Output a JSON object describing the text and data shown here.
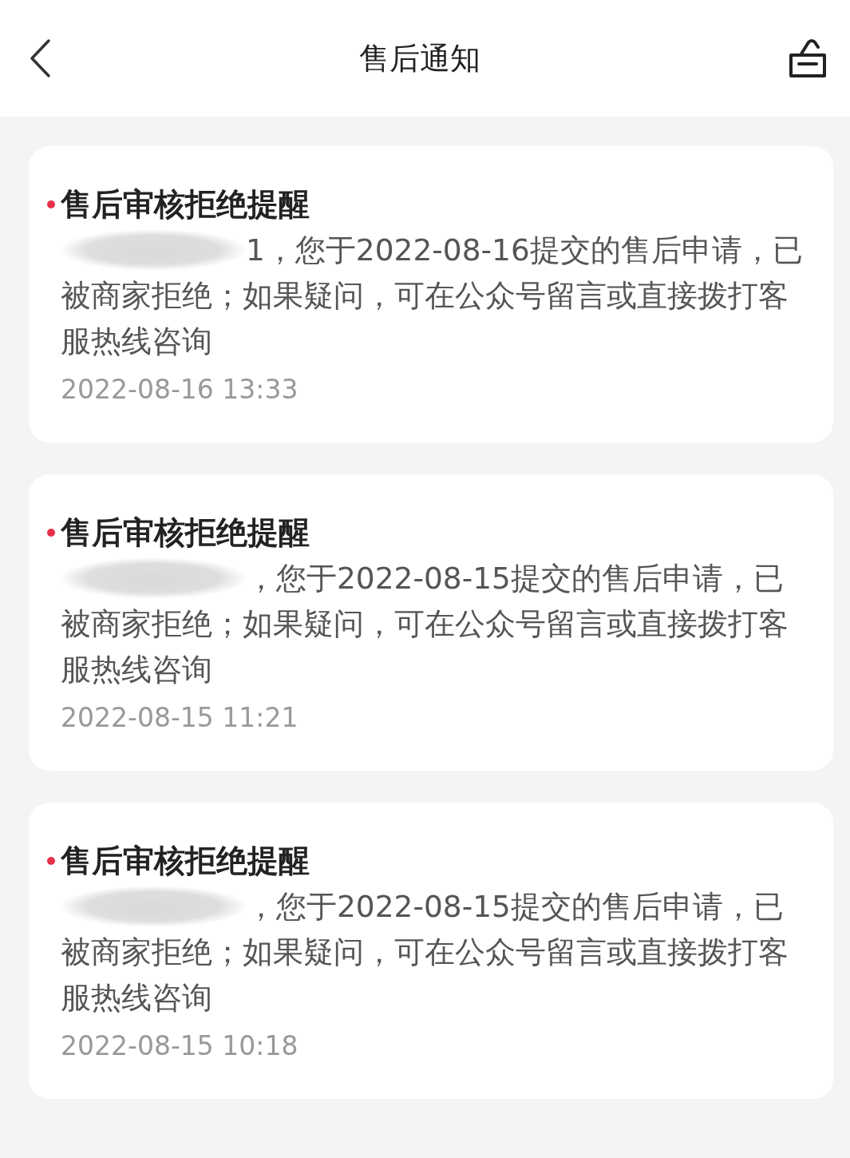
{
  "header": {
    "title": "售后通知"
  },
  "notifications": [
    {
      "unread": true,
      "title": "售后审核拒绝提醒",
      "message": "1，您于2022-08-16提交的售后申请，已被商家拒绝；如果疑问，可在公众号留言或直接拨打客服热线咨询",
      "time": "2022-08-16 13:33"
    },
    {
      "unread": true,
      "title": "售后审核拒绝提醒",
      "message": "，您于2022-08-15提交的售后申请，已被商家拒绝；如果疑问，可在公众号留言或直接拨打客服热线咨询",
      "time": "2022-08-15 11:21"
    },
    {
      "unread": true,
      "title": "售后审核拒绝提醒",
      "message": "，您于2022-08-15提交的售后申请，已被商家拒绝；如果疑问，可在公众号留言或直接拨打客服热线咨询",
      "time": "2022-08-15 10:18"
    }
  ]
}
